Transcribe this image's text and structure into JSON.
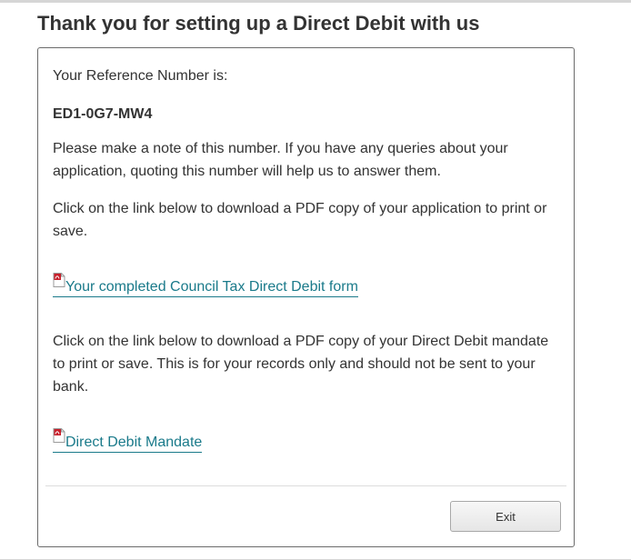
{
  "header": {
    "title": "Thank you for setting up a Direct Debit with us"
  },
  "confirmation": {
    "reference_label": "Your Reference Number is:",
    "reference_number": "ED1-0G7-MW4",
    "note_text": "Please make a note of this number. If you have any queries about your application, quoting this number will help us to answer them.",
    "application_pdf_text": "Click on the link below to download a PDF copy of your application to print or save.",
    "application_link": {
      "label": "Your completed Council Tax Direct Debit form",
      "icon": "pdf-icon"
    },
    "mandate_pdf_text": "Click on the link below to download a PDF copy of your Direct Debit mandate to print or save. This is for your records only and should not be sent to your bank.",
    "mandate_link": {
      "label": "Direct Debit Mandate",
      "icon": "pdf-icon"
    }
  },
  "footer": {
    "exit_label": "Exit"
  },
  "colors": {
    "text": "#333333",
    "link": "#1a7a8a",
    "panel_border": "#6b6b6b",
    "pdf_icon_red": "#c8202b"
  }
}
